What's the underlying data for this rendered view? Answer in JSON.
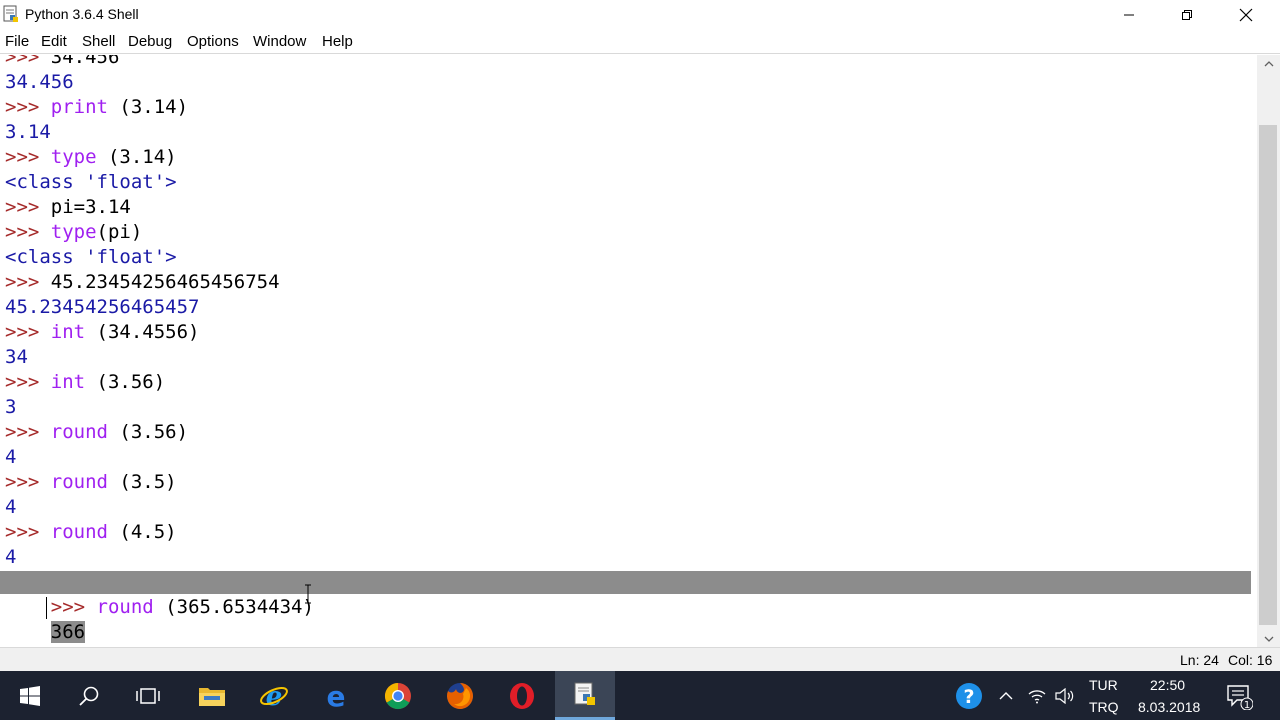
{
  "window": {
    "title": "Python 3.6.4 Shell"
  },
  "menu": [
    "File",
    "Edit",
    "Shell",
    "Debug",
    "Options",
    "Window",
    "Help"
  ],
  "shell": {
    "prompt": ">>>",
    "lines": [
      {
        "type": "input",
        "kw": "",
        "code": "34.456"
      },
      {
        "type": "output",
        "text": "34.456"
      },
      {
        "type": "input",
        "kw": "print",
        "code": " (3.14)"
      },
      {
        "type": "output",
        "text": "3.14"
      },
      {
        "type": "input",
        "kw": "type",
        "code": " (3.14)"
      },
      {
        "type": "output",
        "text": "<class 'float'>"
      },
      {
        "type": "input",
        "kw": "",
        "code": "pi=3.14"
      },
      {
        "type": "input",
        "kw": "type",
        "code": "(pi)"
      },
      {
        "type": "output",
        "text": "<class 'float'>"
      },
      {
        "type": "input",
        "kw": "",
        "code": "45.23454256465456754"
      },
      {
        "type": "output",
        "text": "45.23454256465457"
      },
      {
        "type": "input",
        "kw": "int",
        "code": " (34.4556)"
      },
      {
        "type": "output",
        "text": "34"
      },
      {
        "type": "input",
        "kw": "int",
        "code": " (3.56)"
      },
      {
        "type": "output",
        "text": "3"
      },
      {
        "type": "input",
        "kw": "round",
        "code": " (3.56)"
      },
      {
        "type": "output",
        "text": "4"
      },
      {
        "type": "input",
        "kw": "round",
        "code": " (3.5)"
      },
      {
        "type": "output",
        "text": "4"
      },
      {
        "type": "input",
        "kw": "round",
        "code": " (4.5)"
      },
      {
        "type": "output",
        "text": "4"
      }
    ],
    "last_input": {
      "kw": "round",
      "code_unselected": " (365.",
      "code_selected": "6534434)"
    },
    "last_output": "366",
    "final_prompt": ">>>"
  },
  "status": {
    "ln": "Ln: 24",
    "col": "Col: 16"
  },
  "taskbar": {
    "items": [
      "start-icon",
      "search-icon",
      "task-view-icon",
      "file-explorer-icon",
      "internet-explorer-icon",
      "edge-icon",
      "chrome-icon",
      "firefox-icon",
      "opera-icon",
      "python-idle-icon"
    ],
    "lang_top": "TUR",
    "lang_bottom": "TRQ",
    "time": "22:50",
    "date": "8.03.2018",
    "notification_count": "1"
  },
  "colors": {
    "prompt": "#a52a2a",
    "keyword": "#a020f0",
    "output": "#1a1aa6",
    "selection": "#8c8c8c",
    "taskbar": "#1c2230"
  }
}
